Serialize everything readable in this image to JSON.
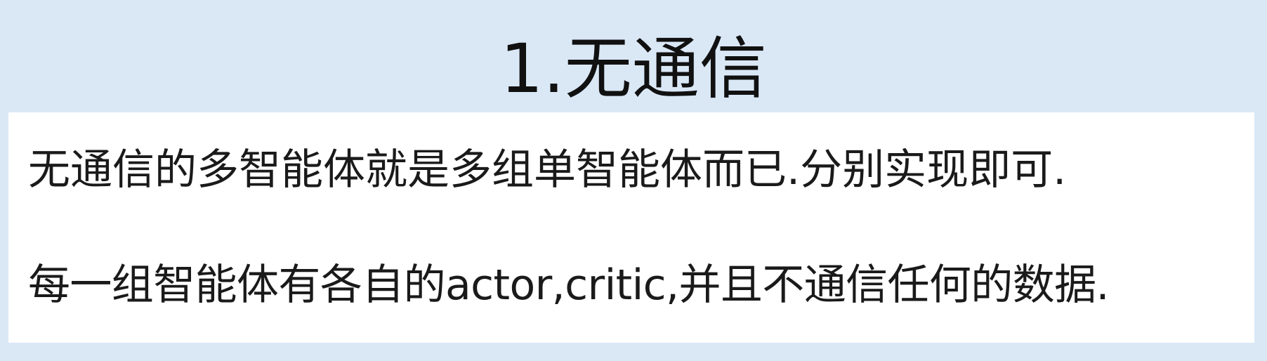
{
  "slide": {
    "title": "1.无通信",
    "lines": [
      "无通信的多智能体就是多组单智能体而已.分别实现即可.",
      "每一组智能体有各自的actor,critic,并且不通信任何的数据."
    ]
  },
  "colors": {
    "background": "#dae8f6",
    "content_background": "#ffffff",
    "text": "#111111"
  }
}
